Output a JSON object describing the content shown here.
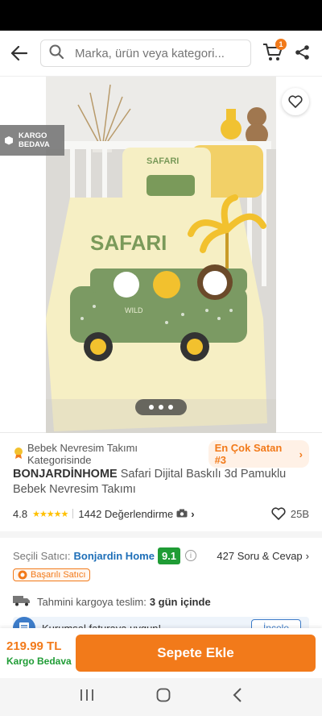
{
  "search": {
    "placeholder": "Marka, ürün veya kategori..."
  },
  "cart": {
    "count": "1"
  },
  "gallery": {
    "kargo_line1": "KARGO",
    "kargo_line2": "BEDAVA",
    "dot_count": 3,
    "image_text": {
      "safari": "SAFARI",
      "wild": "WILD"
    }
  },
  "product": {
    "category_text": "Bebek Nevresim Takımı Kategorisinde",
    "best_seller": "En Çok Satan #3",
    "brand": "BONJARDİNHOME",
    "name": "Safari Dijital Baskılı 3d Pamuklu Bebek Nevresim Takımı",
    "rating": "4.8",
    "stars": 5,
    "review_count": "1442 Değerlendirme",
    "fav_count": "25B"
  },
  "seller": {
    "label": "Seçili Satıcı:",
    "name": "Bonjardin Home",
    "score": "9.1",
    "qa": "427 Soru & Cevap",
    "badge": "Başarılı Satıcı"
  },
  "shipping": {
    "label": "Tahmini kargoya teslim:",
    "value": "3 gün içinde"
  },
  "invoice": {
    "text": "Kurumsal faturaya uygun!",
    "button": "İncele"
  },
  "bottom": {
    "price": "219.99 TL",
    "shipping": "Kargo Bedava",
    "add_button": "Sepete Ekle"
  },
  "colors": {
    "accent": "#f27a1a",
    "seller_score": "#1f9c35",
    "link": "#1e6fb8"
  }
}
